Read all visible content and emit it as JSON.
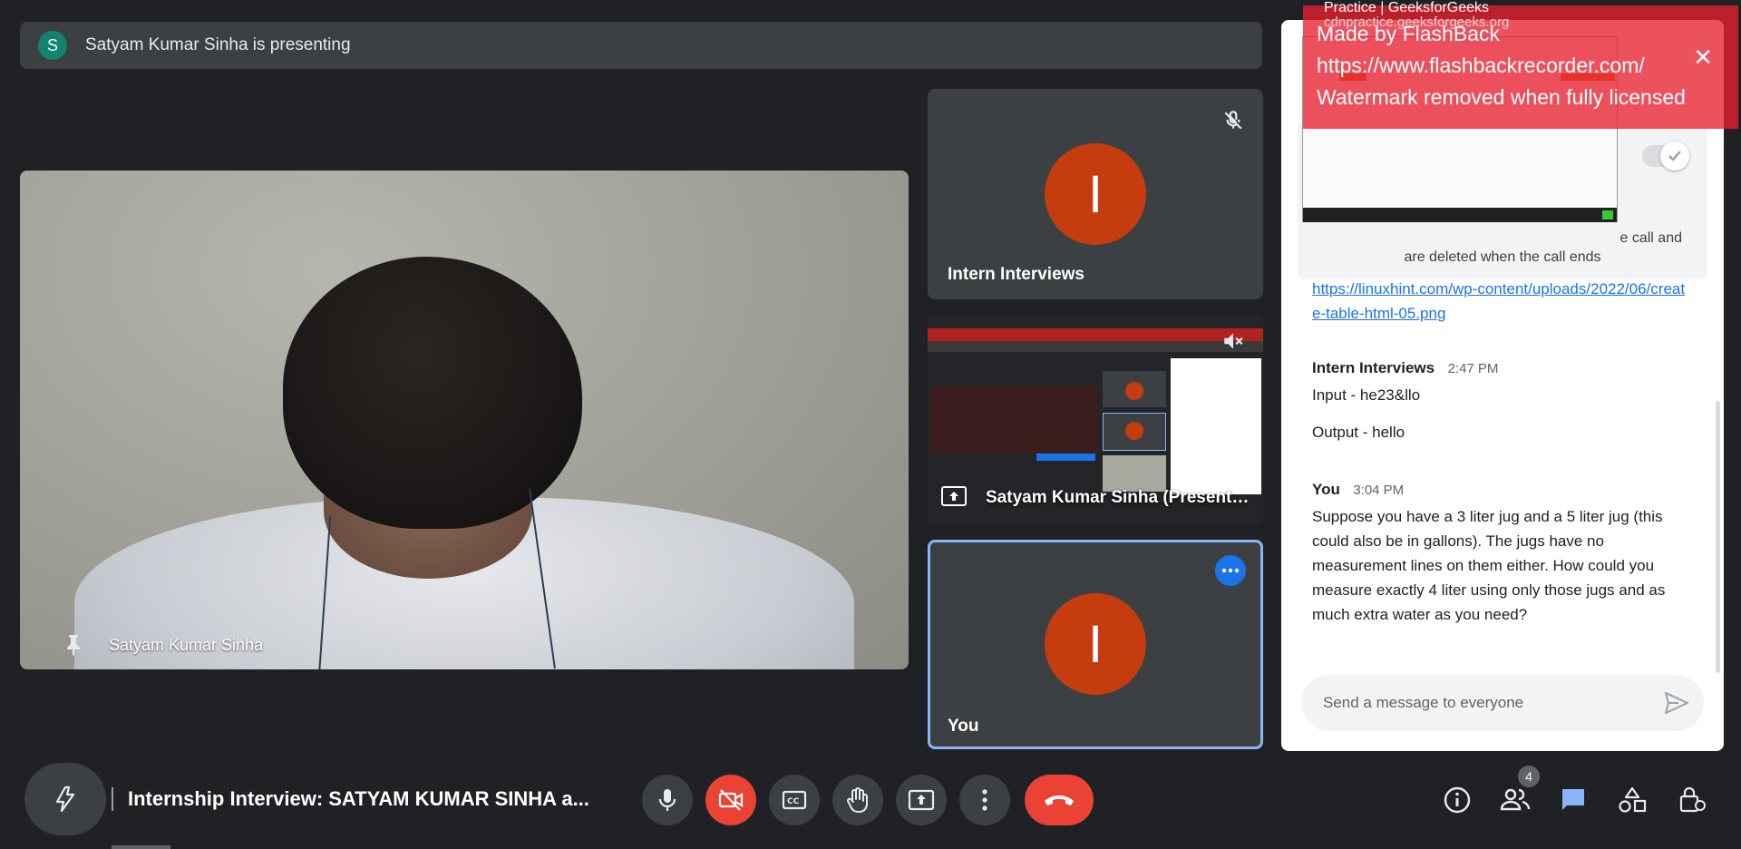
{
  "presenting": {
    "avatar_letter": "S",
    "text": "Satyam Kumar Sinha is presenting"
  },
  "main_video": {
    "name": "Satyam Kumar Sinha"
  },
  "tiles": [
    {
      "name": "Intern Interviews",
      "avatar_letter": "I",
      "muted": true
    },
    {
      "name": "Satyam Kumar Sinha (Present…",
      "type": "screen-share",
      "muted": true
    },
    {
      "name": "You",
      "avatar_letter": "I",
      "active": true
    }
  ],
  "chat": {
    "notice_text_line1": "e call and",
    "notice_text_line2": "are deleted when the call ends",
    "link": "https://linuxhint.com/wp-content/uploads/2022/06/create-table-html-05.png",
    "messages": [
      {
        "sender": "Intern Interviews",
        "time": "2:47 PM",
        "lines": [
          "Input - he23&llo",
          "Output - hello"
        ]
      },
      {
        "sender": "You",
        "time": "3:04 PM",
        "lines": [
          "Suppose you have a 3 liter jug and a 5 liter jug (this",
          "could also be in gallons). The jugs have no",
          "measurement lines on them either. How could you",
          "measure exactly 4 liter using only those jugs and as",
          "much extra water as you need?"
        ]
      }
    ],
    "input_placeholder": "Send a message to everyone"
  },
  "watermark": {
    "tab_title": "Practice | GeeksforGeeks",
    "tab_url": "cdnpractice.geeksforgeeks.org",
    "line1": "Made by FlashBack",
    "line2": "https://www.flashbackrecorder.com/",
    "line3": "Watermark removed when fully licensed",
    "close": "✕"
  },
  "bottom_bar": {
    "meeting_title": "Internship Interview: SATYAM KUMAR SINHA a...",
    "people_count": "4"
  },
  "colors": {
    "accent": "#1a73e8",
    "danger": "#ea4335",
    "avatar": "#c53d0f",
    "bg": "#202124",
    "tile": "#3c4043"
  }
}
